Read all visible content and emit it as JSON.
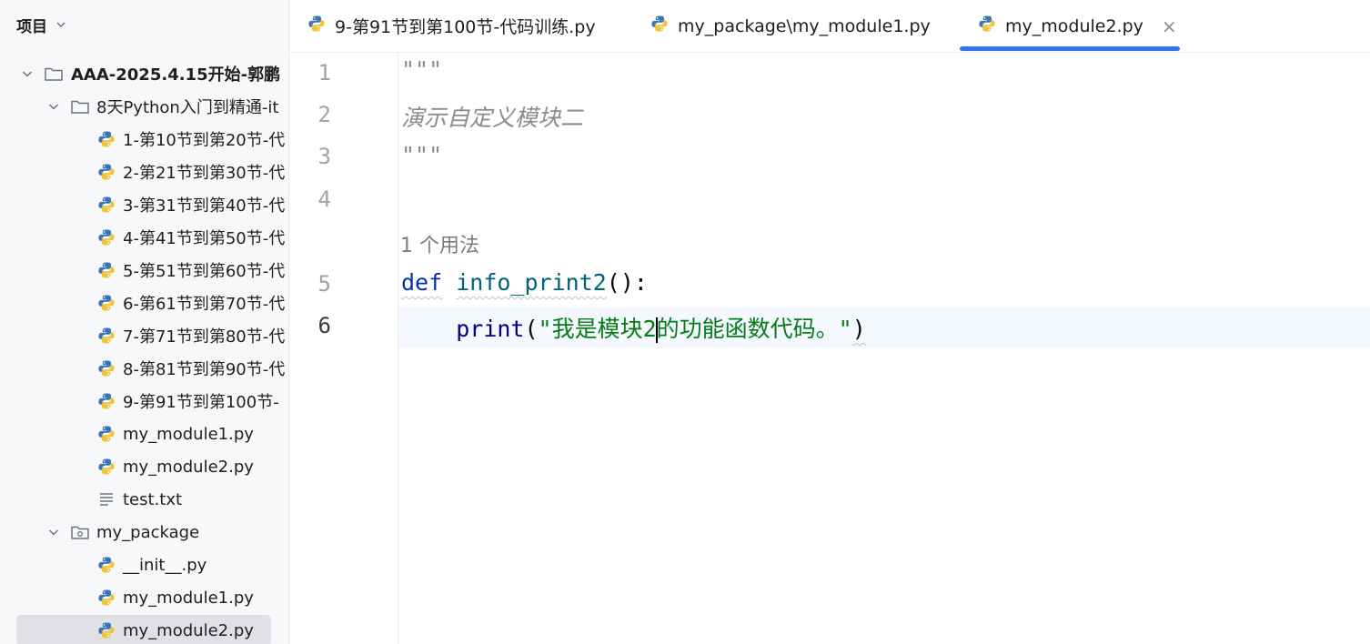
{
  "sidebar": {
    "title": "项目",
    "tree": [
      {
        "label": "AAA-2025.4.15开始-郭鹏",
        "type": "folder",
        "expanded": true,
        "level": 0,
        "bold": true
      },
      {
        "label": "8天Python入门到精通-it",
        "type": "folder",
        "expanded": true,
        "level": 1
      },
      {
        "label": "1-第10节到第20节-代",
        "type": "py",
        "level": 2
      },
      {
        "label": "2-第21节到第30节-代",
        "type": "py",
        "level": 2
      },
      {
        "label": "3-第31节到第40节-代",
        "type": "py",
        "level": 2
      },
      {
        "label": "4-第41节到第50节-代",
        "type": "py",
        "level": 2
      },
      {
        "label": "5-第51节到第60节-代",
        "type": "py",
        "level": 2
      },
      {
        "label": "6-第61节到第70节-代",
        "type": "py",
        "level": 2
      },
      {
        "label": "7-第71节到第80节-代",
        "type": "py",
        "level": 2
      },
      {
        "label": "8-第81节到第90节-代",
        "type": "py",
        "level": 2
      },
      {
        "label": "9-第91节到第100节-",
        "type": "py",
        "level": 2
      },
      {
        "label": "my_module1.py",
        "type": "py",
        "level": 2
      },
      {
        "label": "my_module2.py",
        "type": "py",
        "level": 2
      },
      {
        "label": "test.txt",
        "type": "txt",
        "level": 2
      },
      {
        "label": "my_package",
        "type": "package",
        "expanded": true,
        "level": 1
      },
      {
        "label": "__init__.py",
        "type": "py",
        "level": 2
      },
      {
        "label": "my_module1.py",
        "type": "py",
        "level": 2
      },
      {
        "label": "my_module2.py",
        "type": "py",
        "level": 2,
        "selected": true
      }
    ]
  },
  "tabs": [
    {
      "label": "9-第91节到第100节-代码训练.py"
    },
    {
      "label": "my_package\\my_module1.py"
    },
    {
      "label": "my_module2.py",
      "active": true
    }
  ],
  "tab_close": "×",
  "editor": {
    "line_numbers": [
      "1",
      "2",
      "3",
      "4",
      "5",
      "6"
    ],
    "current_line": "6",
    "usage_hint": "1 个用法",
    "lines": {
      "l1": "\"\"\"",
      "l2": "演示自定义模块二",
      "l3": "\"\"\"",
      "l5_kw": "def",
      "l5_fn": "info_print2",
      "l5_rest": "():",
      "l6_builtin": "print",
      "l6_open": "(",
      "l6_str_a": "\"我是模块2",
      "l6_str_b": "的功能函数代码。\"",
      "l6_close": ")"
    }
  },
  "colors": {
    "accent": "#3574f0",
    "keyword": "#0033b3",
    "function": "#00627a",
    "string": "#067d17",
    "docstring": "#8c8c8c"
  }
}
